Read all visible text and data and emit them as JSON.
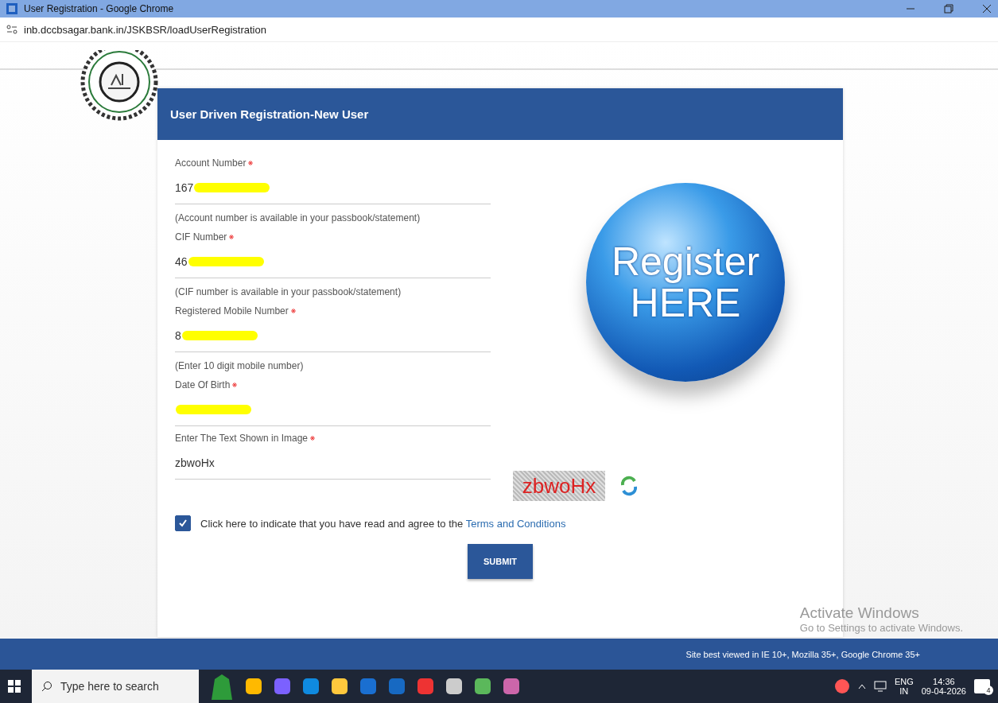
{
  "window": {
    "title": "User Registration - Google Chrome"
  },
  "address_bar": {
    "url": "inb.dccbsagar.bank.in/JSKBSR/loadUserRegistration"
  },
  "form": {
    "title": "User Driven Registration-New User",
    "fields": [
      {
        "label": "Account Number",
        "required": true,
        "value": "167",
        "redacted": true,
        "hint": "(Account number is available in your passbook/statement)"
      },
      {
        "label": "CIF Number",
        "required": true,
        "value": "46",
        "redacted": true,
        "hint": "(CIF number is available in your passbook/statement)"
      },
      {
        "label": "Registered Mobile Number",
        "required": true,
        "value": "8",
        "redacted": true,
        "hint": "(Enter 10 digit mobile number)"
      },
      {
        "label": "Date Of Birth",
        "required": true,
        "redacted": true
      },
      {
        "label": "Enter The Text Shown in Image",
        "required": true,
        "value": "zbwoHx"
      }
    ],
    "captcha": {
      "text": "zbwoHx"
    },
    "agreement": {
      "checked": true,
      "text": "Click here to indicate that you have read and agree to the",
      "link": "Terms and Conditions"
    },
    "submit": "SUBMIT"
  },
  "banner": {
    "line1": "Register",
    "line2": "HERE"
  },
  "footer": "Site best viewed in IE 10+, Mozilla 35+, Google Chrome 35+",
  "activation": {
    "title": "Activate Windows",
    "subtitle": "Go to Settings to activate Windows."
  },
  "taskbar": {
    "search_placeholder": "Type here to search",
    "language": "ENG",
    "region": "IN",
    "time": "14:36",
    "date": "09-04-2026",
    "notification_count": "4"
  }
}
